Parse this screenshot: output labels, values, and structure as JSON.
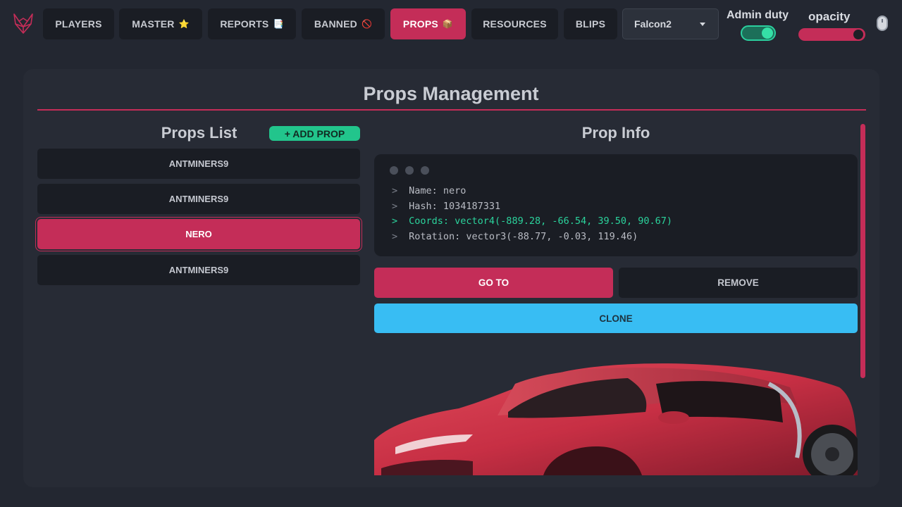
{
  "nav": {
    "tabs": [
      {
        "label": "PLAYERS",
        "emoji": ""
      },
      {
        "label": "MASTER",
        "emoji": "⭐"
      },
      {
        "label": "REPORTS",
        "emoji": "📑"
      },
      {
        "label": "BANNED",
        "emoji": "🚫"
      },
      {
        "label": "PROPS",
        "emoji": "📦"
      },
      {
        "label": "RESOURCES",
        "emoji": ""
      },
      {
        "label": "BLIPS",
        "emoji": ""
      }
    ],
    "active_tab": "PROPS",
    "dropdown_value": "Falcon2",
    "admin_duty_label": "Admin duty",
    "admin_duty_on": true,
    "opacity_label": "opacity",
    "opacity_level": 1.0
  },
  "panel": {
    "title": "Props Management"
  },
  "props_list": {
    "title": "Props List",
    "add_label": "+ ADD PROP",
    "items": [
      "ANTMINERS9",
      "ANTMINERS9",
      "NERO",
      "ANTMINERS9"
    ],
    "selected_index": 2
  },
  "prop_info": {
    "title": "Prop Info",
    "lines": [
      {
        "prompt": ">",
        "text": "Name: nero"
      },
      {
        "prompt": ">",
        "text": "Hash: 1034187331"
      },
      {
        "prompt": ">",
        "text": "Coords: vector4(-889.28, -66.54, 39.50, 90.67)"
      },
      {
        "prompt": ">",
        "text": "Rotation: vector3(-88.77, -0.03, 119.46)"
      }
    ],
    "goto_label": "GO TO",
    "remove_label": "REMOVE",
    "clone_label": "CLONE"
  },
  "colors": {
    "accent": "#c42d58",
    "success": "#22c58c",
    "info": "#38bdf3",
    "background": "#232731",
    "panel": "#272b35"
  },
  "icons": [
    "fox-logo-icon",
    "star-icon",
    "document-icon",
    "prohibited-icon",
    "package-icon",
    "caret-down-icon",
    "mouse-icon"
  ]
}
